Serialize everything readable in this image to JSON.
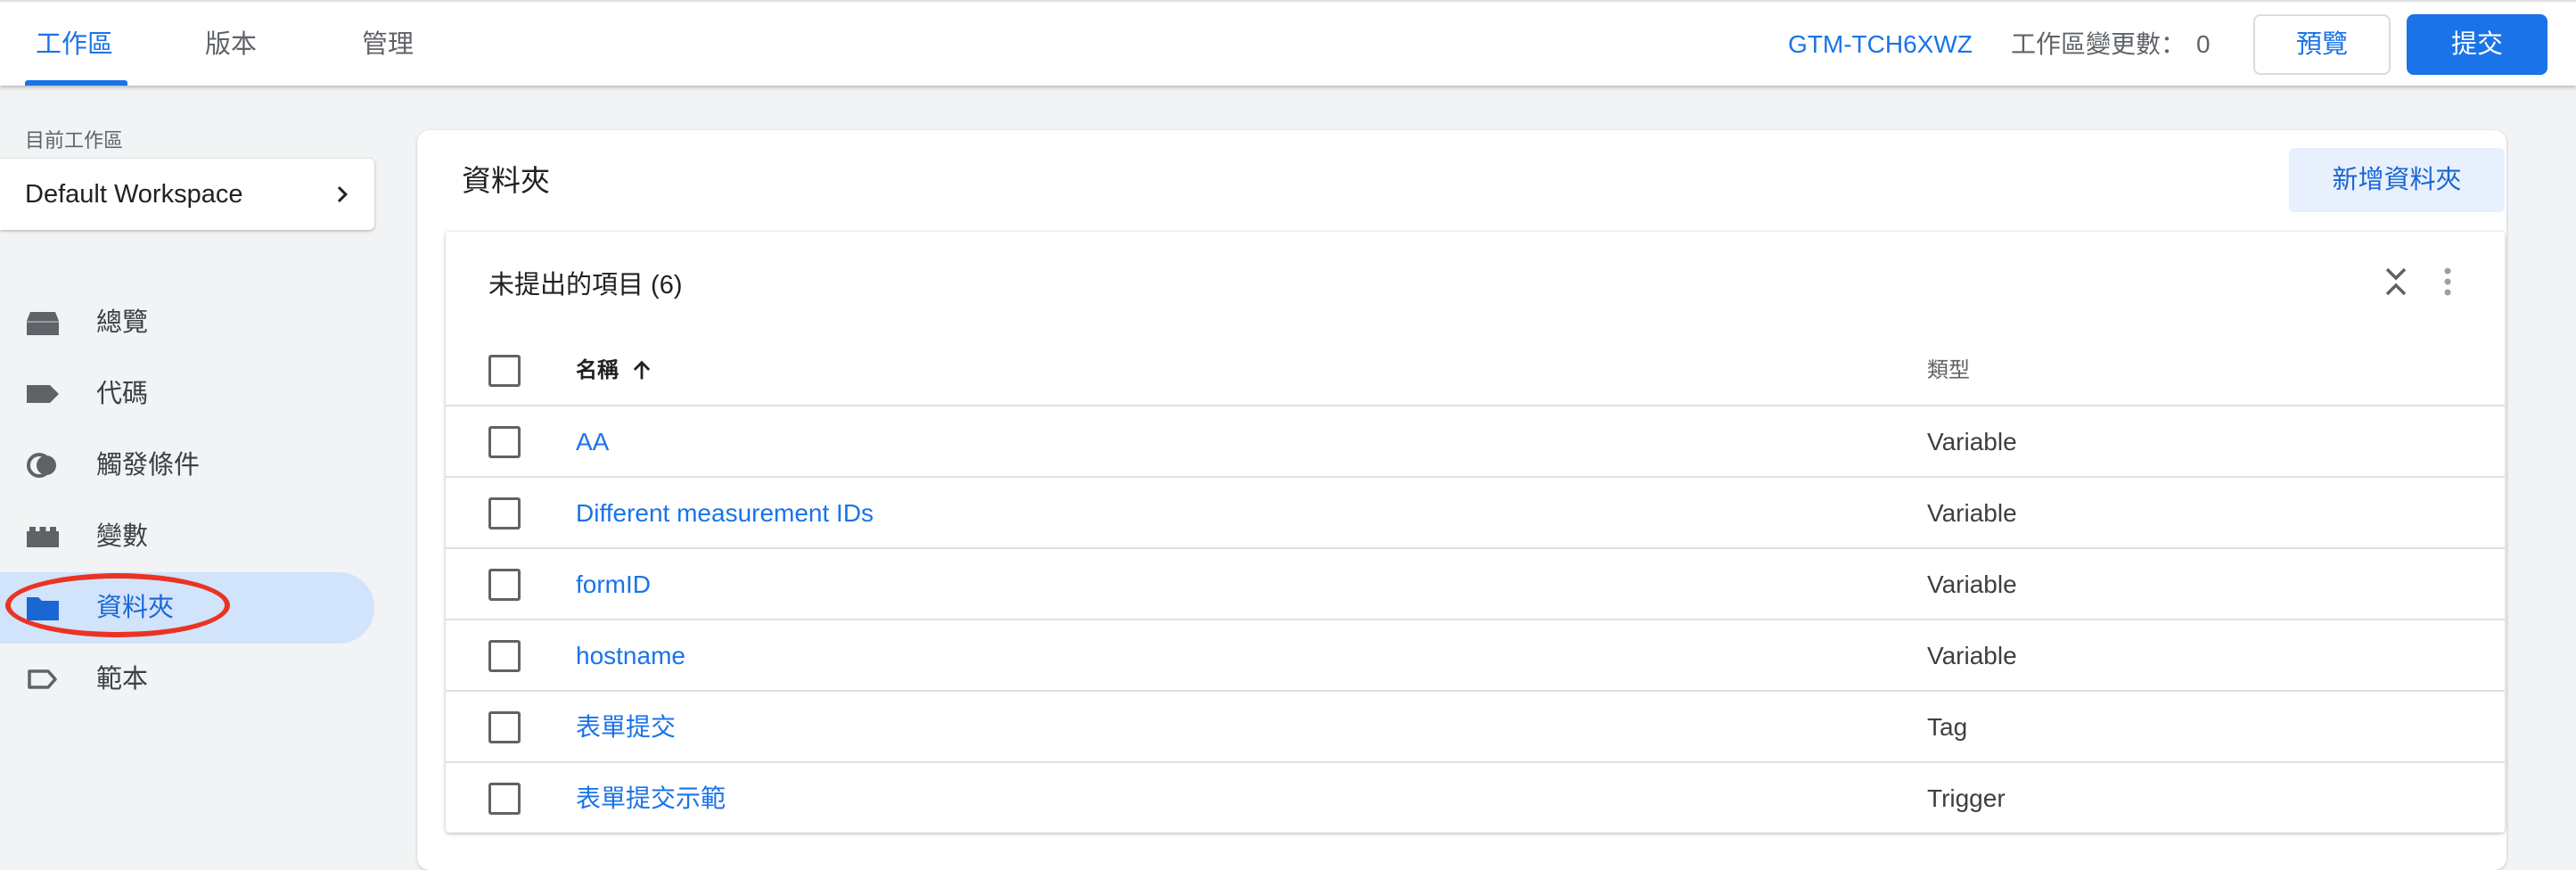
{
  "topbar": {
    "tabs": [
      {
        "label": "工作區",
        "active": true
      },
      {
        "label": "版本",
        "active": false
      },
      {
        "label": "管理",
        "active": false
      }
    ],
    "container_id": "GTM-TCH6XWZ",
    "changes_label": "工作區變更數：",
    "changes_count": "0",
    "preview_label": "預覽",
    "submit_label": "提交"
  },
  "sidebar": {
    "workspace_label": "目前工作區",
    "workspace_name": "Default Workspace",
    "items": [
      {
        "label": "總覽",
        "icon": "overview-icon",
        "active": false
      },
      {
        "label": "代碼",
        "icon": "tag-icon",
        "active": false
      },
      {
        "label": "觸發條件",
        "icon": "trigger-icon",
        "active": false
      },
      {
        "label": "變數",
        "icon": "variable-icon",
        "active": false
      },
      {
        "label": "資料夾",
        "icon": "folder-icon",
        "active": true
      },
      {
        "label": "範本",
        "icon": "template-icon",
        "active": false
      }
    ]
  },
  "main": {
    "title": "資料夾",
    "new_folder_label": "新增資料夾",
    "folder": {
      "title": "未提出的項目 (6)",
      "columns": {
        "name": "名稱",
        "type": "類型"
      },
      "rows": [
        {
          "name": "AA",
          "type": "Variable"
        },
        {
          "name": "Different measurement IDs",
          "type": "Variable"
        },
        {
          "name": "formID",
          "type": "Variable"
        },
        {
          "name": "hostname",
          "type": "Variable"
        },
        {
          "name": "表單提交",
          "type": "Tag"
        },
        {
          "name": "表單提交示範",
          "type": "Trigger"
        }
      ]
    }
  },
  "colors": {
    "accent": "#1a73e8",
    "active_nav_bg": "#d2e3fc",
    "annotation_circle": "#ea3323"
  }
}
